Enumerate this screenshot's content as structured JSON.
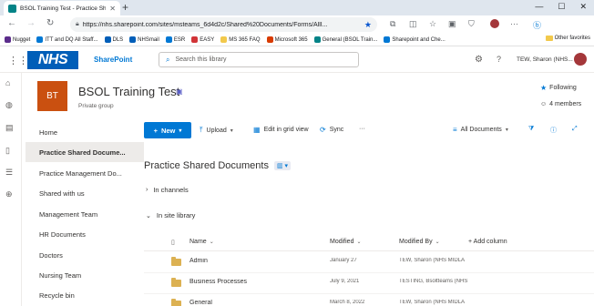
{
  "browser": {
    "tab_title": "BSOL Training Test - Practice Sh...",
    "tab_close": "✕",
    "new_tab": "+",
    "window_controls": [
      "—",
      "☐",
      "✕"
    ],
    "url": "https://nhs.sharepoint.com/sites/msteams_6d4d2c/Shared%20Documents/Forms/AllI...",
    "bookmarks": [
      {
        "label": "Nugget",
        "color": "#5b2c8b"
      },
      {
        "label": "ITT and DQ All Staff...",
        "color": "#0078d4"
      },
      {
        "label": "DLS",
        "color": "#005eb8"
      },
      {
        "label": "NHSmail",
        "color": "#005eb8"
      },
      {
        "label": "ESR",
        "color": "#0078d4"
      },
      {
        "label": "EASY",
        "color": "#d13438"
      },
      {
        "label": "MS 365 FAQ",
        "color": "#f2c94c"
      },
      {
        "label": "Microsoft 365",
        "color": "#d83b01"
      },
      {
        "label": "General (BSOL Train...",
        "color": "#038387"
      },
      {
        "label": "Sharepoint and Che...",
        "color": "#0078d4"
      }
    ],
    "other_favorites": "Other favorites"
  },
  "sp_header": {
    "logo": "NHS",
    "app_name": "SharePoint",
    "search_placeholder": "Search this library",
    "user_name": "TEW, Sharon (NHS..."
  },
  "site": {
    "logo_initials": "BT",
    "title": "BSOL Training Test",
    "subtitle": "Private group",
    "following": "Following",
    "members": "4 members"
  },
  "left_nav": [
    {
      "label": "Home",
      "selected": false
    },
    {
      "label": "Practice Shared Docume...",
      "selected": true
    },
    {
      "label": "Practice Management Do...",
      "selected": false
    },
    {
      "label": "Shared with us",
      "selected": false
    },
    {
      "label": "Management Team",
      "selected": false
    },
    {
      "label": "HR Documents",
      "selected": false
    },
    {
      "label": "Doctors",
      "selected": false
    },
    {
      "label": "Nursing Team",
      "selected": false
    },
    {
      "label": "Recycle bin",
      "selected": false
    }
  ],
  "commands": {
    "new": "New",
    "upload": "Upload",
    "edit_grid": "Edit in grid view",
    "sync": "Sync",
    "more": "···",
    "view": "All Documents"
  },
  "library": {
    "title": "Practice Shared Documents",
    "sections": [
      "In channels",
      "In site library"
    ],
    "columns": {
      "name": "Name",
      "modified": "Modified",
      "modified_by": "Modified By",
      "add_column": "+ Add column"
    },
    "rows": [
      {
        "name": "Admin",
        "modified": "January 27",
        "modified_by": "TEW, Sharon (NHS MIDLA"
      },
      {
        "name": "Business Processes",
        "modified": "July 9, 2021",
        "modified_by": "TESTING, Bsoltteams (NHS"
      },
      {
        "name": "General",
        "modified": "March 8, 2022",
        "modified_by": "TEW, Sharon (NHS MIDLA"
      }
    ]
  },
  "colors": {
    "accent": "#0078d4",
    "nhs_blue": "#005eb8",
    "site_logo": "#ca5010"
  }
}
